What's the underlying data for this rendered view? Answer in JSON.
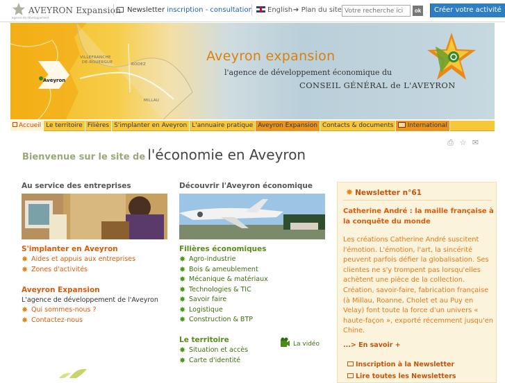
{
  "header": {
    "logo_text": "AVEYRON Expansion",
    "logo_subtext": "agence de développement",
    "newsletter_label": "Newsletter",
    "newsletter_actions": "inscription - consultation",
    "language_label": "English",
    "sitemap_label": "Plan du site",
    "search_placeholder": "Votre recherche ici",
    "search_button": "ok",
    "create_button": "Créer votre activité"
  },
  "banner": {
    "title": "Aveyron expansion",
    "subtitle": "l'agence de développement économique du",
    "subtitle2": "CONSEIL GÉNÉRAL de L'AVEYRON",
    "map_labels": [
      "VILLEFRANCHE",
      "DE-ROUERGUE",
      "RODEZ",
      "MILLAU"
    ],
    "map_marker": "Aveyron"
  },
  "nav": {
    "items": [
      "Accueil",
      "Le territoire",
      "Filières",
      "S'implanter en Aveyron",
      "L'annuaire pratique",
      "Aveyron Expansion",
      "Contacts & documents",
      "International"
    ]
  },
  "welcome": {
    "small": "Bienvenue sur le site de",
    "big": "l'économie en Aveyron"
  },
  "left": {
    "heading": "Au service des entreprises",
    "section1_title": "S'implanter en Aveyron",
    "section1_items": [
      "Aides et appuis aux entreprises",
      "Zones d'activités"
    ],
    "section2_title": "Aveyron Expansion",
    "section2_text": "L'agence de développement de l'Aveyron",
    "section2_items": [
      "Qui sommes-nous ?",
      "Contactez-nous"
    ]
  },
  "middle": {
    "heading": "Découvrir l'Aveyron économique",
    "section1_title": "Filières économiques",
    "section1_items": [
      "Agro-industrie",
      "Bois & ameublement",
      "Mécanique & matériaux",
      "Technologies & TIC",
      "Savoir faire",
      "Logistique",
      "Construction & BTP"
    ],
    "section2_title": "Le territoire",
    "section2_items": [
      "Situation et accès",
      "Carte d'identité"
    ],
    "video_label": "La vidéo"
  },
  "newsletter_box": {
    "heading": "Newsletter n°61",
    "article_title": "Catherine André : la maille française à la conquête du monde",
    "article_text": "Les créations Catherine André suscitent l'émotion. L'émotion, l'art, la sincérité peuvent parfois défier la globalisation. Ses clientes ne s'y trompent pas lorsqu'elles achètent une pièce de la collection. Création, savoir-faire, fabrication française (à Millau, Roanne, Cholet et au Puy en Velay) font toute la force d'un univers « haute-façon », exporté récemment jusqu'en Chine.",
    "more_label": "...> En savoir +",
    "subscribe_label": "Inscription à la Newsletter",
    "all_label": "Lire toutes les Newsletters"
  },
  "colors": {
    "accent_orange": "#d85a0a",
    "nav_yellow": "#f7c73a",
    "green": "#3e6e10",
    "blue_button": "#2d7ec4"
  }
}
